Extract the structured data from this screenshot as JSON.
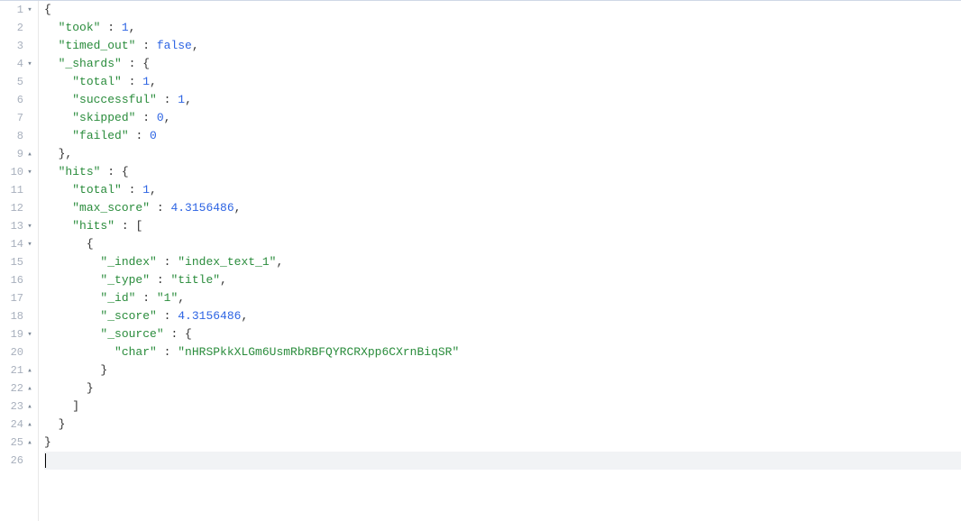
{
  "colors": {
    "key": "#2a8c3c",
    "string": "#2a8c3c",
    "number": "#2d64e3",
    "boolean": "#2d64e3",
    "punctuation": "#333333",
    "gutter_text": "#a8b0bd",
    "active_line_bg": "#f1f3f5"
  },
  "active_line": 26,
  "json_data": {
    "took": 1,
    "timed_out": false,
    "_shards": {
      "total": 1,
      "successful": 1,
      "skipped": 0,
      "failed": 0
    },
    "hits": {
      "total": 1,
      "max_score": 4.3156486,
      "hits": [
        {
          "_index": "index_text_1",
          "_type": "title",
          "_id": "1",
          "_score": 4.3156486,
          "_source": {
            "char": "nHRSPkkXLGm6UsmRbRBFQYRCRXpp6CXrnBiqSR"
          }
        }
      ]
    }
  },
  "lines": [
    {
      "n": 1,
      "fold": "open",
      "indent": 0,
      "tokens": [
        [
          "brace",
          "{"
        ]
      ]
    },
    {
      "n": 2,
      "fold": "",
      "indent": 1,
      "tokens": [
        [
          "key",
          "took"
        ],
        [
          "punc",
          " : "
        ],
        [
          "num",
          "1"
        ],
        [
          "punc",
          ","
        ]
      ]
    },
    {
      "n": 3,
      "fold": "",
      "indent": 1,
      "tokens": [
        [
          "key",
          "timed_out"
        ],
        [
          "punc",
          " : "
        ],
        [
          "bool",
          "false"
        ],
        [
          "punc",
          ","
        ]
      ]
    },
    {
      "n": 4,
      "fold": "open",
      "indent": 1,
      "tokens": [
        [
          "key",
          "_shards"
        ],
        [
          "punc",
          " : "
        ],
        [
          "brace",
          "{"
        ]
      ]
    },
    {
      "n": 5,
      "fold": "",
      "indent": 2,
      "tokens": [
        [
          "key",
          "total"
        ],
        [
          "punc",
          " : "
        ],
        [
          "num",
          "1"
        ],
        [
          "punc",
          ","
        ]
      ]
    },
    {
      "n": 6,
      "fold": "",
      "indent": 2,
      "tokens": [
        [
          "key",
          "successful"
        ],
        [
          "punc",
          " : "
        ],
        [
          "num",
          "1"
        ],
        [
          "punc",
          ","
        ]
      ]
    },
    {
      "n": 7,
      "fold": "",
      "indent": 2,
      "tokens": [
        [
          "key",
          "skipped"
        ],
        [
          "punc",
          " : "
        ],
        [
          "num",
          "0"
        ],
        [
          "punc",
          ","
        ]
      ]
    },
    {
      "n": 8,
      "fold": "",
      "indent": 2,
      "tokens": [
        [
          "key",
          "failed"
        ],
        [
          "punc",
          " : "
        ],
        [
          "num",
          "0"
        ]
      ]
    },
    {
      "n": 9,
      "fold": "close",
      "indent": 1,
      "tokens": [
        [
          "brace",
          "}"
        ],
        [
          "punc",
          ","
        ]
      ]
    },
    {
      "n": 10,
      "fold": "open",
      "indent": 1,
      "tokens": [
        [
          "key",
          "hits"
        ],
        [
          "punc",
          " : "
        ],
        [
          "brace",
          "{"
        ]
      ]
    },
    {
      "n": 11,
      "fold": "",
      "indent": 2,
      "tokens": [
        [
          "key",
          "total"
        ],
        [
          "punc",
          " : "
        ],
        [
          "num",
          "1"
        ],
        [
          "punc",
          ","
        ]
      ]
    },
    {
      "n": 12,
      "fold": "",
      "indent": 2,
      "tokens": [
        [
          "key",
          "max_score"
        ],
        [
          "punc",
          " : "
        ],
        [
          "num",
          "4.3156486"
        ],
        [
          "punc",
          ","
        ]
      ]
    },
    {
      "n": 13,
      "fold": "open",
      "indent": 2,
      "tokens": [
        [
          "key",
          "hits"
        ],
        [
          "punc",
          " : "
        ],
        [
          "brace",
          "["
        ]
      ]
    },
    {
      "n": 14,
      "fold": "open",
      "indent": 3,
      "tokens": [
        [
          "brace",
          "{"
        ]
      ]
    },
    {
      "n": 15,
      "fold": "",
      "indent": 4,
      "tokens": [
        [
          "key",
          "_index"
        ],
        [
          "punc",
          " : "
        ],
        [
          "str",
          "index_text_1"
        ],
        [
          "punc",
          ","
        ]
      ]
    },
    {
      "n": 16,
      "fold": "",
      "indent": 4,
      "tokens": [
        [
          "key",
          "_type"
        ],
        [
          "punc",
          " : "
        ],
        [
          "str",
          "title"
        ],
        [
          "punc",
          ","
        ]
      ]
    },
    {
      "n": 17,
      "fold": "",
      "indent": 4,
      "tokens": [
        [
          "key",
          "_id"
        ],
        [
          "punc",
          " : "
        ],
        [
          "str",
          "1"
        ],
        [
          "punc",
          ","
        ]
      ]
    },
    {
      "n": 18,
      "fold": "",
      "indent": 4,
      "tokens": [
        [
          "key",
          "_score"
        ],
        [
          "punc",
          " : "
        ],
        [
          "num",
          "4.3156486"
        ],
        [
          "punc",
          ","
        ]
      ]
    },
    {
      "n": 19,
      "fold": "open",
      "indent": 4,
      "tokens": [
        [
          "key",
          "_source"
        ],
        [
          "punc",
          " : "
        ],
        [
          "brace",
          "{"
        ]
      ]
    },
    {
      "n": 20,
      "fold": "",
      "indent": 5,
      "tokens": [
        [
          "key",
          "char"
        ],
        [
          "punc",
          " : "
        ],
        [
          "str",
          "nHRSPkkXLGm6UsmRbRBFQYRCRXpp6CXrnBiqSR"
        ]
      ]
    },
    {
      "n": 21,
      "fold": "close",
      "indent": 4,
      "tokens": [
        [
          "brace",
          "}"
        ]
      ]
    },
    {
      "n": 22,
      "fold": "close",
      "indent": 3,
      "tokens": [
        [
          "brace",
          "}"
        ]
      ]
    },
    {
      "n": 23,
      "fold": "close",
      "indent": 2,
      "tokens": [
        [
          "brace",
          "]"
        ]
      ]
    },
    {
      "n": 24,
      "fold": "close",
      "indent": 1,
      "tokens": [
        [
          "brace",
          "}"
        ]
      ]
    },
    {
      "n": 25,
      "fold": "close",
      "indent": 0,
      "tokens": [
        [
          "brace",
          "}"
        ]
      ]
    },
    {
      "n": 26,
      "fold": "",
      "indent": 0,
      "tokens": []
    }
  ]
}
